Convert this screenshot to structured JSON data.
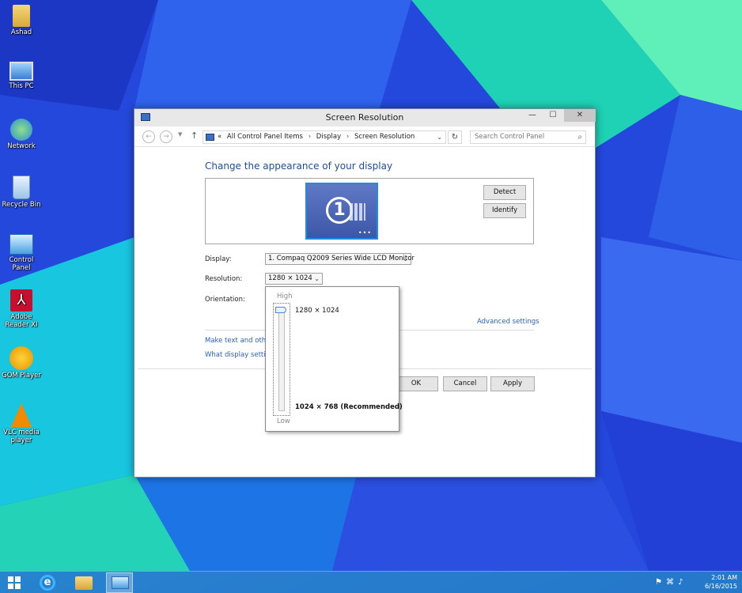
{
  "desktop": {
    "icons": [
      {
        "label": "Ashad"
      },
      {
        "label": "This PC"
      },
      {
        "label": "Network"
      },
      {
        "label": "Recycle Bin"
      },
      {
        "label": "Control Panel"
      },
      {
        "label": "Adobe Reader XI"
      },
      {
        "label": "GOM Player"
      },
      {
        "label": "VLC media player"
      }
    ]
  },
  "window": {
    "title": "Screen Resolution",
    "minimize": "—",
    "maximize": "☐",
    "close": "✕",
    "address": {
      "back": "←",
      "forward": "→",
      "up": "↑",
      "prefix": "«",
      "crumbs": [
        "All Control Panel Items",
        "Display",
        "Screen Resolution"
      ],
      "sep": "›",
      "refresh": "↻",
      "search_placeholder": "Search Control Panel"
    },
    "heading": "Change the appearance of your display",
    "monitor_number": "1",
    "detect_label": "Detect",
    "identify_label": "Identify",
    "display_label": "Display:",
    "display_value": "1. Compaq Q2009 Series Wide LCD Monitor",
    "resolution_label": "Resolution:",
    "resolution_value": "1280 × 1024",
    "orientation_label": "Orientation:",
    "advanced_settings": "Advanced settings",
    "link_make_text": "Make text and other",
    "link_what_display": "What display setting",
    "ok_label": "OK",
    "cancel_label": "Cancel",
    "apply_label": "Apply"
  },
  "resolution_popup": {
    "high_label": "High",
    "low_label": "Low",
    "options": [
      "1280 × 1024",
      "1024 × 768 (Recommended)"
    ],
    "slider_level": 1.0
  },
  "taskbar": {
    "time": "2:01 AM",
    "date": "6/16/2015"
  },
  "colors": {
    "heading": "#1e4c9a",
    "link": "#2a62c0",
    "taskbar": "#2882c8"
  }
}
